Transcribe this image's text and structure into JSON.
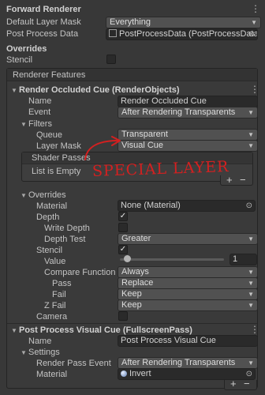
{
  "forward_renderer": {
    "title": "Forward Renderer",
    "default_layer_mask_label": "Default Layer Mask",
    "default_layer_mask_value": "Everything",
    "post_process_data_label": "Post Process Data",
    "post_process_data_value": "PostProcessData (PostProcessData)"
  },
  "overrides": {
    "title": "Overrides",
    "stencil_label": "Stencil"
  },
  "renderer_features": {
    "title": "Renderer Features",
    "render_objects": {
      "title": "Render Occluded Cue (RenderObjects)",
      "name_label": "Name",
      "name_value": "Render Occluded Cue",
      "event_label": "Event",
      "event_value": "After Rendering Transparents",
      "filters_label": "Filters",
      "queue_label": "Queue",
      "queue_value": "Transparent",
      "layer_mask_label": "Layer Mask",
      "layer_mask_value": "Visual Cue",
      "shader_passes_label": "Shader Passes",
      "list_empty_label": "List is Empty",
      "add_label": "+",
      "remove_label": "−",
      "annotation": "SPECIAL LAYER",
      "overrides_label": "Overrides",
      "material_label": "Material",
      "material_value": "None (Material)",
      "depth_label": "Depth",
      "write_depth_label": "Write Depth",
      "depth_test_label": "Depth Test",
      "depth_test_value": "Greater",
      "stencil_label": "Stencil",
      "value_label": "Value",
      "value_value": "1",
      "compare_function_label": "Compare Function",
      "compare_function_value": "Always",
      "pass_label": "Pass",
      "pass_value": "Replace",
      "fail_label": "Fail",
      "fail_value": "Keep",
      "zfail_label": "Z Fail",
      "zfail_value": "Keep",
      "camera_label": "Camera"
    },
    "fullscreen_pass": {
      "title": "Post Process Visual Cue (FullscreenPass)",
      "name_label": "Name",
      "name_value": "Post Process Visual Cue",
      "settings_label": "Settings",
      "render_pass_event_label": "Render Pass Event",
      "render_pass_event_value": "After Rendering Transparents",
      "material_label": "Material",
      "material_value": "Invert"
    },
    "add_feature_label": "+",
    "remove_feature_label": "−"
  },
  "checkboxes": {
    "stencil_override": false,
    "depth": true,
    "write_depth": false,
    "stencil": true,
    "camera": false
  },
  "colors": {
    "annotation": "#d42020",
    "background": "#383838"
  },
  "icons": [
    "menu-icon",
    "target-icon",
    "material-icon",
    "slider-knob"
  ]
}
